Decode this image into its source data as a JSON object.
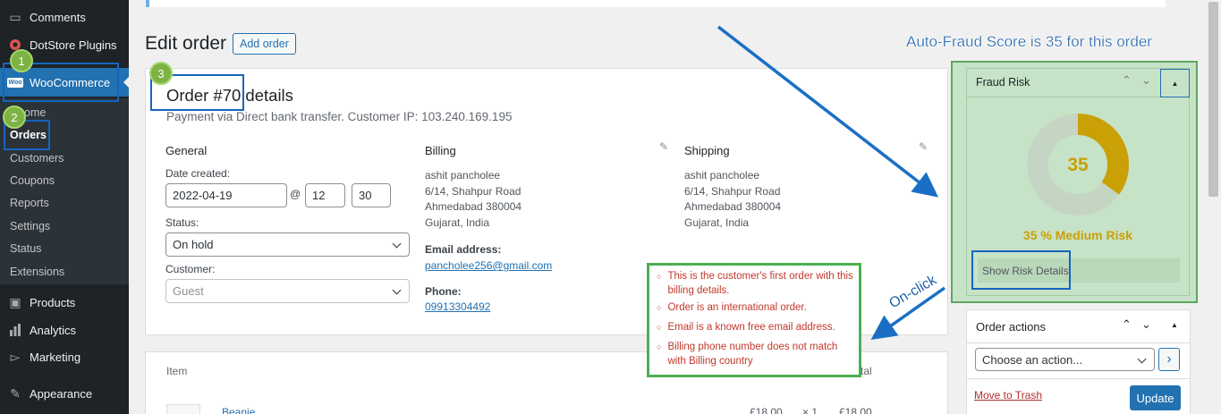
{
  "sidebar": {
    "menu": [
      {
        "label": "Comments",
        "icon": "comments-icon"
      },
      {
        "label": "DotStore Plugins",
        "icon": "dotstore-icon"
      },
      {
        "label": "WooCommerce",
        "icon": "woocommerce-icon"
      },
      {
        "label": "Products",
        "icon": "products-icon"
      },
      {
        "label": "Analytics",
        "icon": "analytics-icon"
      },
      {
        "label": "Marketing",
        "icon": "marketing-icon"
      },
      {
        "label": "Appearance",
        "icon": "appearance-icon"
      }
    ],
    "woo_icon_text": "Woo",
    "submenu": [
      "Home",
      "Orders",
      "Customers",
      "Coupons",
      "Reports",
      "Settings",
      "Status",
      "Extensions"
    ],
    "home_visible": "ome"
  },
  "header": {
    "title": "Edit order",
    "add_button": "Add order"
  },
  "order": {
    "title": "Order #70 details",
    "subtitle": "Payment via Direct bank transfer. Customer IP: 103.240.169.195",
    "general": {
      "heading": "General",
      "date_label": "Date created:",
      "date_value": "2022-04-19",
      "at": "@",
      "hour": "12",
      "minute": "30",
      "status_label": "Status:",
      "status_value": "On hold",
      "customer_label": "Customer:",
      "customer_placeholder": "Guest"
    },
    "billing": {
      "heading": "Billing",
      "address": [
        "ashit pancholee",
        "6/14, Shahpur Road",
        "Ahmedabad 380004",
        "Gujarat, India"
      ],
      "email_label": "Email address:",
      "email": "pancholee256@gmail.com",
      "phone_label": "Phone:",
      "phone": "09913304492"
    },
    "shipping": {
      "heading": "Shipping",
      "address": [
        "ashit pancholee",
        "6/14, Shahpur Road",
        "Ahmedabad 380004",
        "Gujarat, India"
      ]
    }
  },
  "items": {
    "header_item": "Item",
    "header_total_partial": "tal",
    "row": {
      "name": "Beanie",
      "cost": "£18.00",
      "qty": "× 1",
      "total": "£18.00"
    }
  },
  "fraud_box": {
    "title": "Fraud Risk",
    "score": "35",
    "score_fraction": 0.35,
    "risk_text": "35 % Medium Risk",
    "button": "Show Risk Details",
    "colors": {
      "ring": "#c9a006",
      "track": "#c5d5c3",
      "text": "#c9a006",
      "bg": "#c7e3c7"
    }
  },
  "order_actions": {
    "title": "Order actions",
    "select_value": "Choose an action...",
    "go": "›",
    "trash": "Move to Trash",
    "update": "Update"
  },
  "annotations": {
    "top": "Auto-Fraud Score is 35 for this order",
    "onclick": "On-click",
    "badges": [
      "1",
      "2",
      "3"
    ],
    "risk_details": [
      "This is the customer's first order with this billing details.",
      "Order is an international order.",
      "Email is a known free email address.",
      "Billing phone number does not match with Billing country"
    ]
  }
}
